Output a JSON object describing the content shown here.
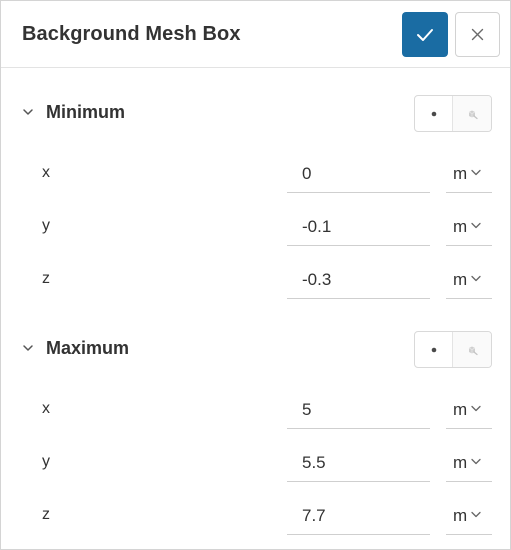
{
  "header": {
    "title": "Background Mesh Box",
    "confirm_icon": "check-icon",
    "close_icon": "close-icon",
    "accent": "#1a6ca3"
  },
  "sections": [
    {
      "label": "Minimum",
      "rows": [
        {
          "axis": "x",
          "value": "0",
          "unit": "m"
        },
        {
          "axis": "y",
          "value": "-0.1",
          "unit": "m"
        },
        {
          "axis": "z",
          "value": "-0.3",
          "unit": "m"
        }
      ]
    },
    {
      "label": "Maximum",
      "rows": [
        {
          "axis": "x",
          "value": "5",
          "unit": "m"
        },
        {
          "axis": "y",
          "value": "5.5",
          "unit": "m"
        },
        {
          "axis": "z",
          "value": "7.7",
          "unit": "m"
        }
      ]
    }
  ]
}
